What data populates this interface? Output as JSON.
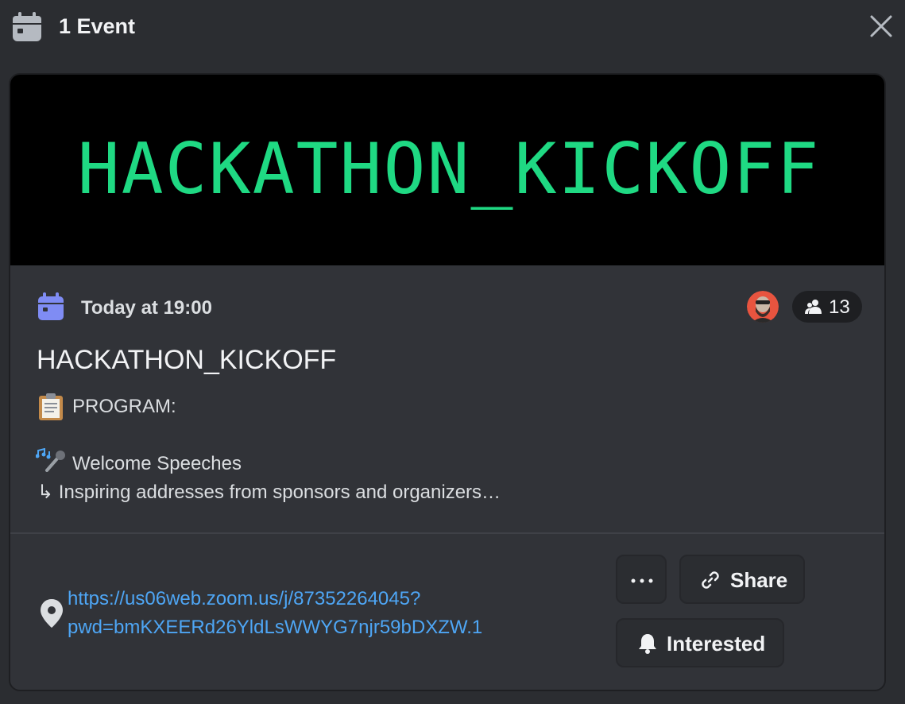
{
  "header": {
    "title": "1 Event",
    "icon": "calendar-icon",
    "close_icon": "close-icon"
  },
  "banner": {
    "text": "HACKATHON_KICKOFF",
    "text_color": "#1fd983",
    "background": "#000000"
  },
  "event": {
    "date": "Today at 19:00",
    "date_icon_color": "#7f8cf4",
    "title": "HACKATHON_KICKOFF",
    "interested_count": "13",
    "description": {
      "line1": "PROGRAM:",
      "line2": "Welcome Speeches",
      "line3": "↳ Inspiring addresses from sponsors and organizers…"
    }
  },
  "location": {
    "link_line1": "https://us06web.zoom.us/j/87352264045?",
    "link_line2": "pwd=bmKXEERd26YldLsWWYG7njr59bDXZW.1",
    "link_color": "#4ea6f5"
  },
  "actions": {
    "more_label": "···",
    "share_label": "Share",
    "interested_label": "Interested"
  }
}
